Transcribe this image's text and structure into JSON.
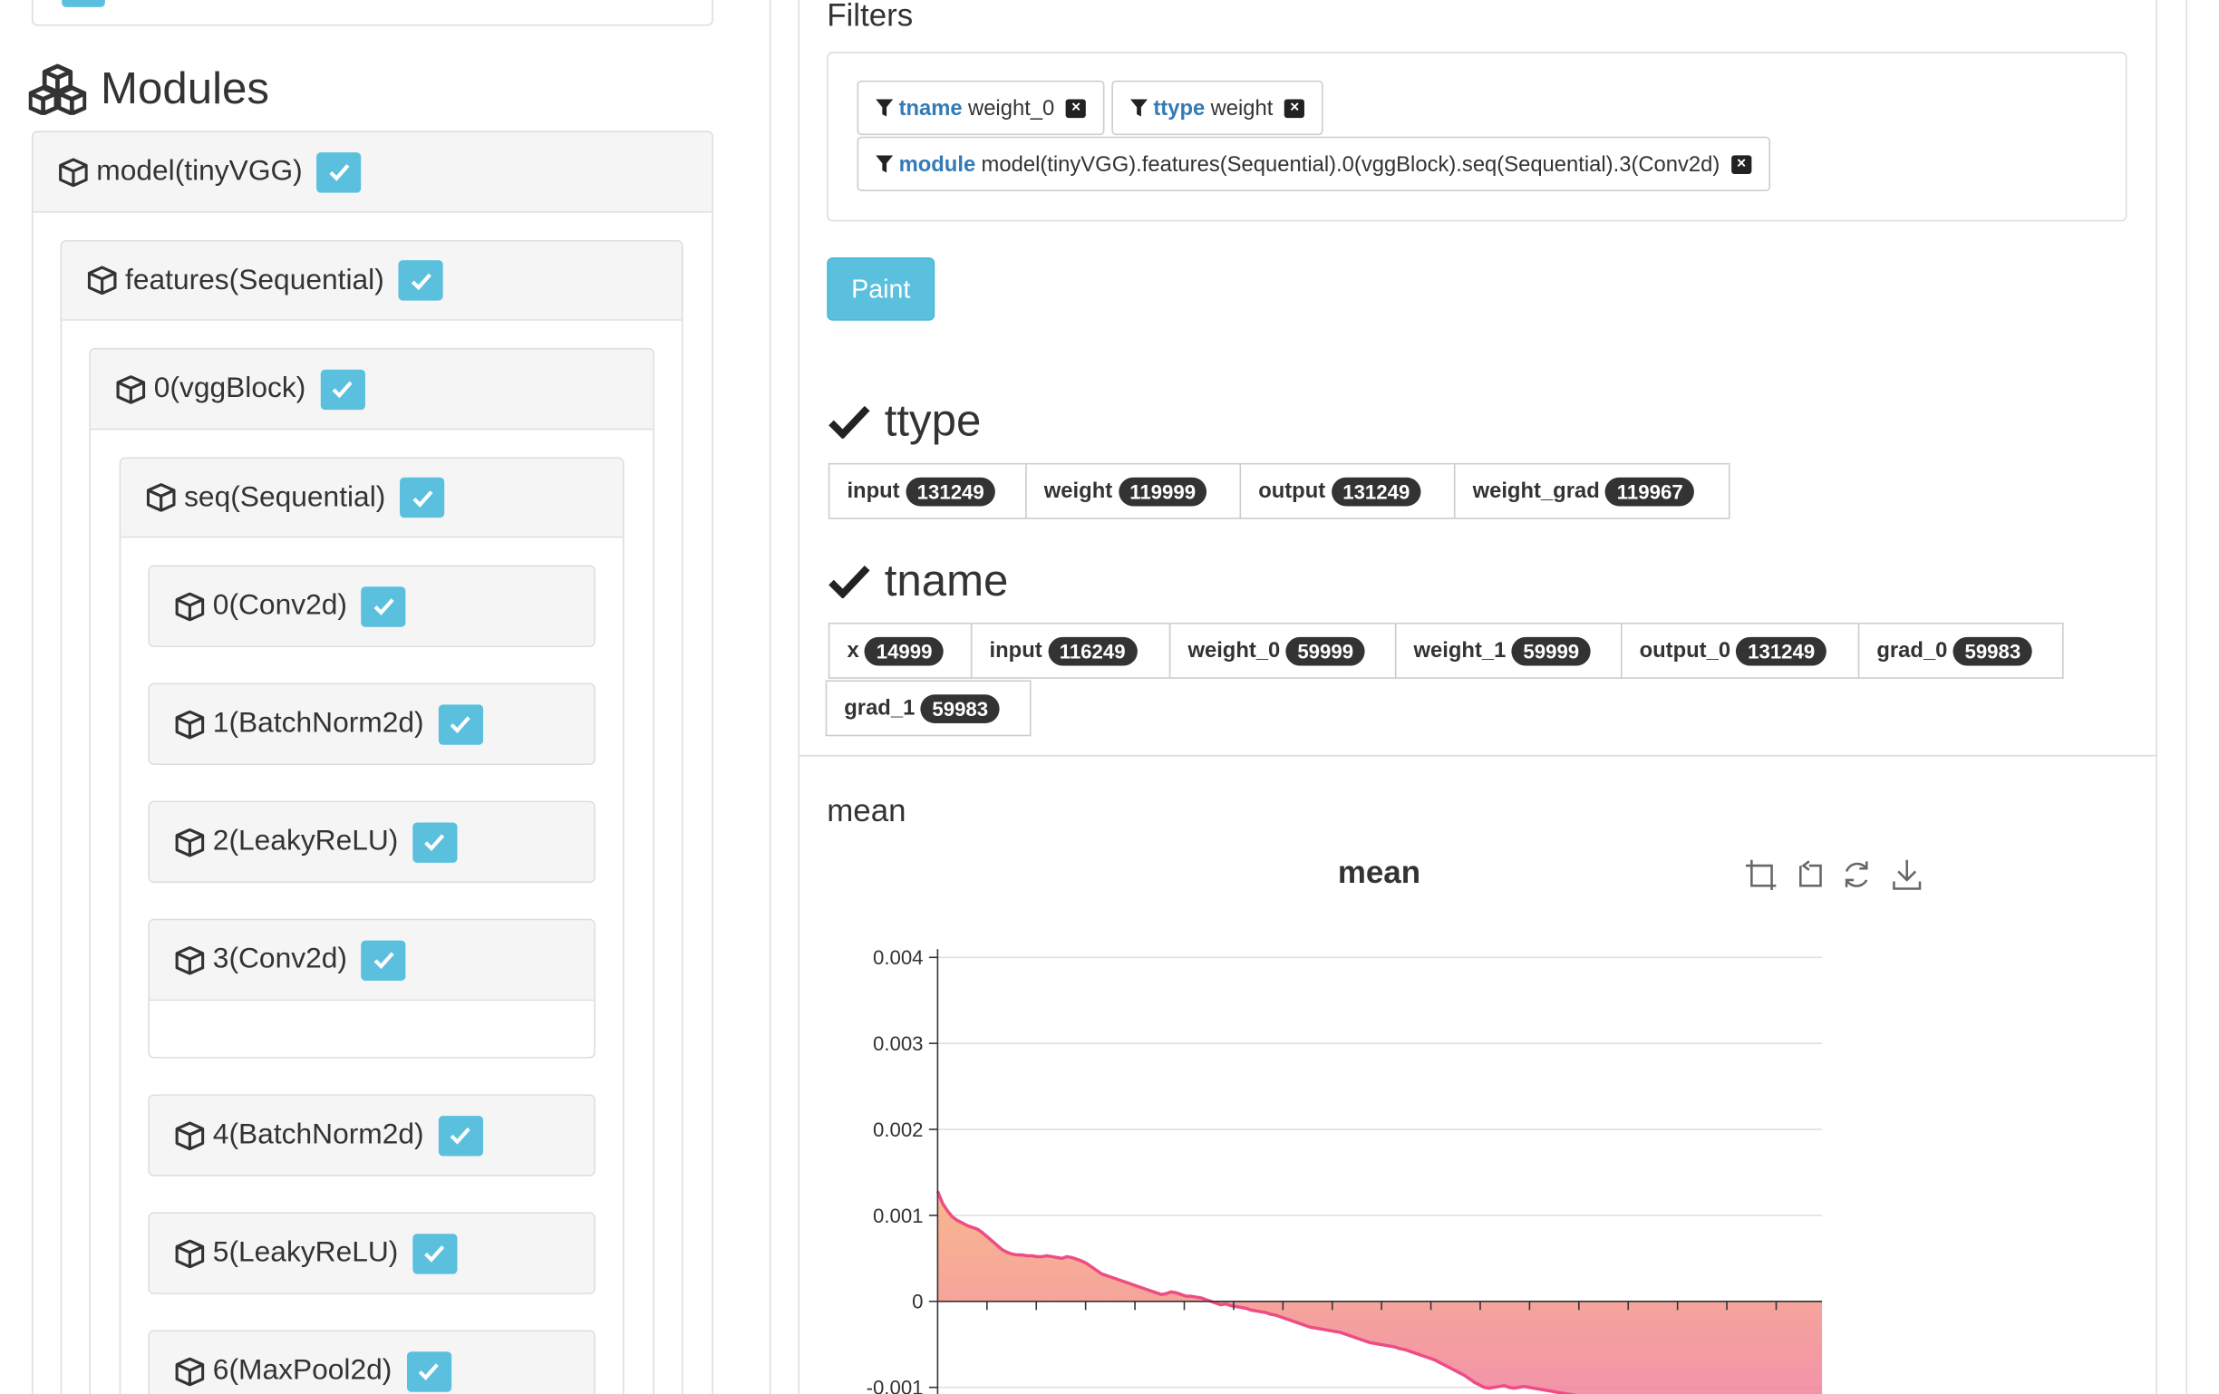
{
  "modules": {
    "title": "Modules",
    "tree": [
      {
        "label": "model(tinyVGG)"
      },
      {
        "label": "features(Sequential)"
      },
      {
        "label": "0(vggBlock)"
      },
      {
        "label": "seq(Sequential)"
      },
      {
        "label": "0(Conv2d)"
      },
      {
        "label": "1(BatchNorm2d)"
      },
      {
        "label": "2(LeakyReLU)"
      },
      {
        "label": "3(Conv2d)"
      },
      {
        "label": "4(BatchNorm2d)"
      },
      {
        "label": "5(LeakyReLU)"
      },
      {
        "label": "6(MaxPool2d)"
      }
    ]
  },
  "filters": {
    "title": "Filters",
    "chips": [
      {
        "key": "tname",
        "value": "weight_0"
      },
      {
        "key": "ttype",
        "value": "weight"
      },
      {
        "key": "module",
        "value": "model(tinyVGG).features(Sequential).0(vggBlock).seq(Sequential).3(Conv2d)"
      }
    ],
    "paint_label": "Paint"
  },
  "ttype": {
    "title": "ttype",
    "tags": [
      {
        "label": "input",
        "count": "131249"
      },
      {
        "label": "weight",
        "count": "119999"
      },
      {
        "label": "output",
        "count": "131249"
      },
      {
        "label": "weight_grad",
        "count": "119967"
      }
    ]
  },
  "tname": {
    "title": "tname",
    "tags": [
      {
        "label": "x",
        "count": "14999"
      },
      {
        "label": "input",
        "count": "116249"
      },
      {
        "label": "weight_0",
        "count": "59999"
      },
      {
        "label": "weight_1",
        "count": "59999"
      },
      {
        "label": "output_0",
        "count": "131249"
      },
      {
        "label": "grad_0",
        "count": "59983"
      },
      {
        "label": "grad_1",
        "count": "59983"
      }
    ]
  },
  "mean_panel": {
    "label": "mean",
    "toolbar_icons": [
      "zoom-select-icon",
      "zoom-reset-icon",
      "restore-icon",
      "download-icon"
    ]
  },
  "colors": {
    "accent": "#5bc0de",
    "link": "#337ab7",
    "line": "#ee4d84",
    "area_top": "#f7b07f",
    "area_bottom": "#f07fa6"
  },
  "chart_data": {
    "type": "area",
    "title": "mean",
    "xlabel": "",
    "ylabel": "",
    "ylim": [
      -0.0011,
      0.004
    ],
    "yticks": [
      "0.004",
      "0.003",
      "0.002",
      "0.001",
      "0",
      "-0.001"
    ],
    "grid": true,
    "series": [
      {
        "x": [
          0,
          1,
          2,
          3,
          4,
          5,
          6,
          7,
          8,
          9,
          10,
          11,
          12,
          13,
          14,
          15,
          16,
          17,
          18,
          19,
          20,
          21,
          22,
          23,
          24,
          25,
          26,
          27,
          28,
          29,
          30,
          31,
          32,
          33,
          34,
          35,
          36,
          37,
          38,
          39,
          40,
          41,
          42,
          43,
          44,
          45,
          46,
          47,
          48,
          49,
          50,
          51,
          52,
          53,
          54,
          55,
          56,
          57,
          58,
          59,
          60,
          61,
          62,
          63,
          64,
          65,
          66,
          67,
          68,
          69,
          70,
          71,
          72,
          73,
          74,
          75,
          76,
          77,
          78,
          79,
          80,
          81,
          82,
          83,
          84,
          85,
          86,
          87,
          88,
          89,
          90,
          91,
          92,
          93,
          94,
          95,
          96,
          97,
          98,
          99,
          100,
          101,
          102,
          103,
          104,
          105,
          106,
          107,
          108,
          109,
          110,
          111,
          112,
          113,
          114,
          115,
          116,
          117,
          118,
          119,
          120,
          121,
          122,
          123,
          124,
          125,
          126,
          127,
          128,
          129,
          130,
          131,
          132,
          133,
          134,
          135,
          136,
          137,
          138,
          139,
          140,
          141,
          142,
          143,
          144,
          145,
          146,
          147,
          148,
          149,
          150,
          151,
          152,
          153,
          154,
          155,
          156,
          157,
          158,
          159,
          160,
          161,
          162,
          163,
          164,
          165,
          166,
          167,
          168,
          169,
          170,
          171,
          172,
          173,
          174,
          175,
          176,
          177,
          178
        ],
        "values": [
          0.00128,
          0.00114,
          0.00105,
          0.00098,
          0.00094,
          0.00091,
          0.00088,
          0.00086,
          0.00084,
          0.0008,
          0.00075,
          0.0007,
          0.00065,
          0.0006,
          0.00057,
          0.00055,
          0.00054,
          0.00054,
          0.00053,
          0.00053,
          0.00052,
          0.00052,
          0.00053,
          0.00052,
          0.00051,
          0.0005,
          0.00052,
          0.00051,
          0.00049,
          0.00047,
          0.00044,
          0.0004,
          0.00036,
          0.00032,
          0.0003,
          0.00028,
          0.00026,
          0.00024,
          0.00022,
          0.0002,
          0.00018,
          0.00016,
          0.00014,
          0.00012,
          0.0001,
          8e-05,
          9e-05,
          0.00011,
          0.0001,
          8e-05,
          6e-05,
          6e-05,
          5e-05,
          4e-05,
          2e-05,
          0.0,
          -2e-05,
          -4e-05,
          -3e-05,
          -5e-05,
          -6e-05,
          -7e-05,
          -8e-05,
          -0.0001,
          -0.00011,
          -0.00012,
          -0.00013,
          -0.00015,
          -0.00016,
          -0.00018,
          -0.0002,
          -0.00022,
          -0.00024,
          -0.00026,
          -0.00028,
          -0.0003,
          -0.00031,
          -0.00032,
          -0.00033,
          -0.00034,
          -0.00035,
          -0.00036,
          -0.00038,
          -0.0004,
          -0.00042,
          -0.00044,
          -0.00046,
          -0.00048,
          -0.00049,
          -0.0005,
          -0.00051,
          -0.00052,
          -0.00053,
          -0.00055,
          -0.00056,
          -0.00058,
          -0.0006,
          -0.00062,
          -0.00064,
          -0.00066,
          -0.00068,
          -0.00071,
          -0.00074,
          -0.00077,
          -0.0008,
          -0.00083,
          -0.00086,
          -0.0009,
          -0.00094,
          -0.00097,
          -0.001,
          -0.00101,
          -0.001,
          -0.00099,
          -0.00098,
          -0.001,
          -0.00101,
          -0.001,
          -0.00099,
          -0.001,
          -0.00101,
          -0.00102,
          -0.00103,
          -0.00104,
          -0.00105,
          -0.00106,
          -0.00107,
          -0.00108,
          -0.00109,
          -0.0011,
          -0.00111,
          -0.00112,
          -0.00113,
          -0.00114,
          -0.00115,
          -0.00116,
          -0.00117,
          -0.00118,
          -0.00119,
          -0.0012,
          -0.00121,
          -0.00122,
          -0.00123,
          -0.00124,
          -0.00125,
          -0.00126,
          -0.00127,
          -0.00128,
          -0.00129,
          -0.0013,
          -0.00131,
          -0.00132,
          -0.00133,
          -0.00134,
          -0.00135,
          -0.00136,
          -0.00137,
          -0.00138,
          -0.00139,
          -0.0014,
          -0.00141,
          -0.00142,
          -0.00143,
          -0.00144,
          -0.00145,
          -0.00146,
          -0.00147,
          -0.00148,
          -0.00149,
          -0.0015,
          -0.00151,
          -0.00152,
          -0.00153,
          -0.00154,
          -0.00155,
          -0.00156,
          -0.00157,
          -0.00158,
          -0.00159
        ]
      }
    ]
  }
}
